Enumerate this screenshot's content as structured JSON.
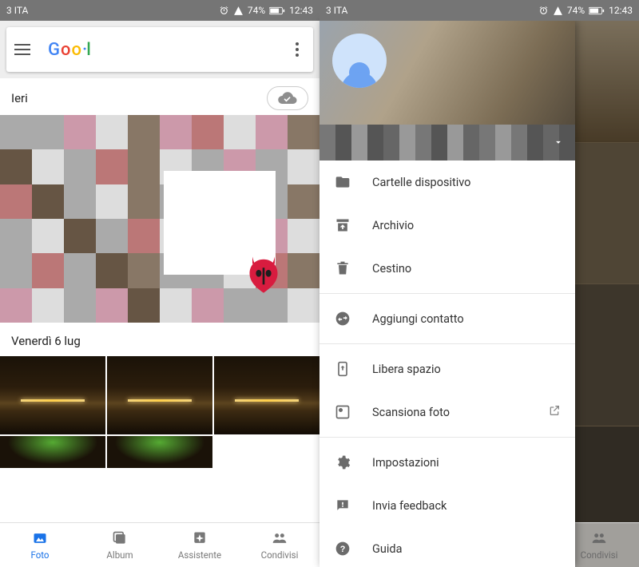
{
  "status": {
    "carrier": "3 ITA",
    "battery": "74%",
    "time": "12:43"
  },
  "left": {
    "section_yesterday": "Ieri",
    "section_day": "Venerdì 6 lug",
    "nav": {
      "photos": "Foto",
      "albums": "Album",
      "assistant": "Assistente",
      "sharing": "Condivisi"
    }
  },
  "right": {
    "drawer": {
      "device_folders": "Cartelle dispositivo",
      "archive": "Archivio",
      "trash": "Cestino",
      "add_contact": "Aggiungi contatto",
      "free_space": "Libera spazio",
      "scan_photos": "Scansiona foto",
      "settings": "Impostazioni",
      "feedback": "Invia feedback",
      "help": "Guida"
    },
    "nav": {
      "sharing": "Condivisi"
    }
  }
}
